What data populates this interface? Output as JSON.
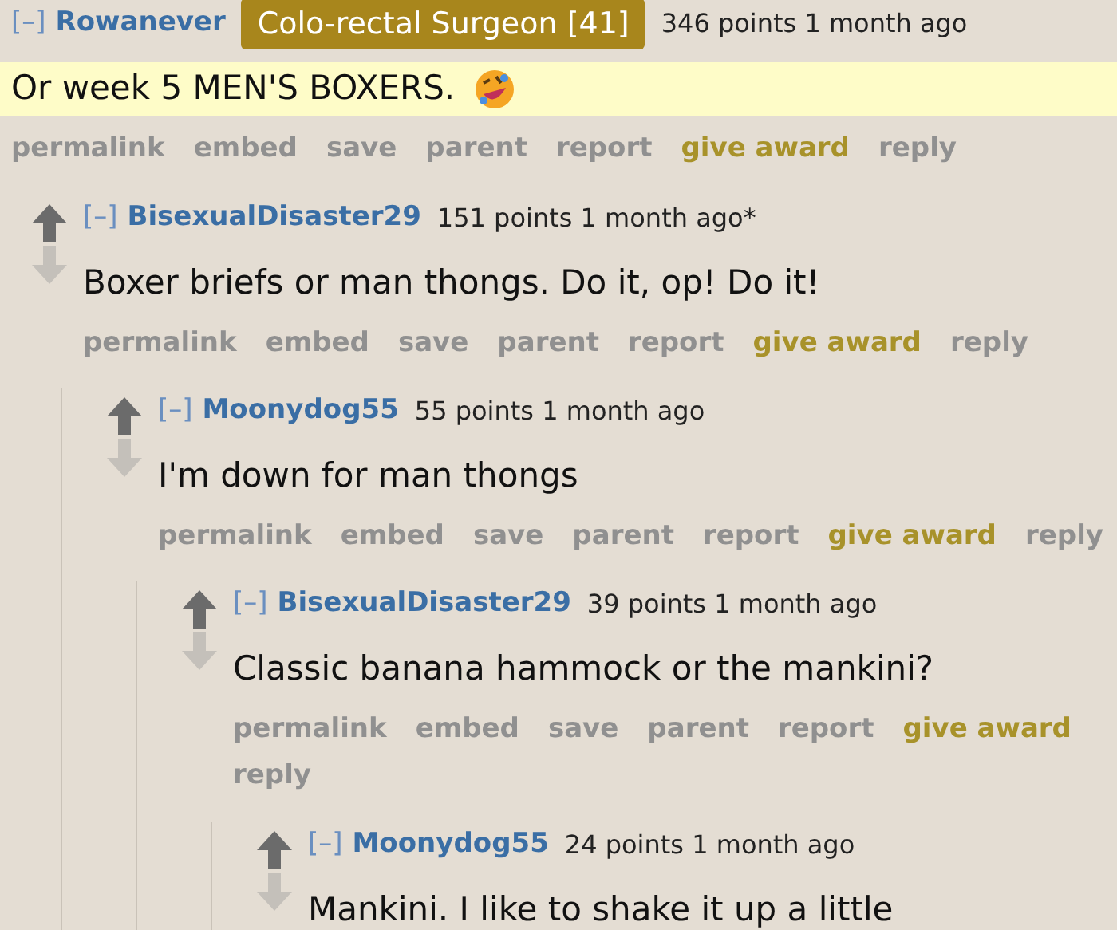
{
  "comments": [
    {
      "toggle": "[–]",
      "author": "Rowanever",
      "flair": "Colo-rectal Surgeon [41]",
      "score": "346 points",
      "time": "1 month ago",
      "vote_arrows": false,
      "highlighted": true,
      "body": "Or week 5 MEN'S BOXERS.",
      "reaction": true,
      "actions": [
        {
          "label": "permalink",
          "kind": "link"
        },
        {
          "label": "embed",
          "kind": "link"
        },
        {
          "label": "save",
          "kind": "link"
        },
        {
          "label": "parent",
          "kind": "link"
        },
        {
          "label": "report",
          "kind": "link"
        },
        {
          "label": "give award",
          "kind": "award"
        },
        {
          "label": "reply",
          "kind": "link"
        }
      ],
      "children": [
        {
          "toggle": "[–]",
          "author": "BisexualDisaster29",
          "score": "151 points",
          "time": "1 month ago*",
          "vote_arrows": true,
          "highlighted": false,
          "body": "Boxer briefs or man thongs. Do it, op! Do it!",
          "reaction": false,
          "actions": [
            {
              "label": "permalink",
              "kind": "link"
            },
            {
              "label": "embed",
              "kind": "link"
            },
            {
              "label": "save",
              "kind": "link"
            },
            {
              "label": "parent",
              "kind": "link"
            },
            {
              "label": "report",
              "kind": "link"
            },
            {
              "label": "give award",
              "kind": "award"
            },
            {
              "label": "reply",
              "kind": "link"
            }
          ],
          "children": [
            {
              "toggle": "[–]",
              "author": "Moonydog55",
              "score": "55 points",
              "time": "1 month ago",
              "vote_arrows": true,
              "highlighted": false,
              "body": "I'm down for man thongs",
              "reaction": false,
              "actions": [
                {
                  "label": "permalink",
                  "kind": "link"
                },
                {
                  "label": "embed",
                  "kind": "link"
                },
                {
                  "label": "save",
                  "kind": "link"
                },
                {
                  "label": "parent",
                  "kind": "link"
                },
                {
                  "label": "report",
                  "kind": "link"
                },
                {
                  "label": "give award",
                  "kind": "award"
                },
                {
                  "label": "reply",
                  "kind": "link"
                }
              ],
              "children": [
                {
                  "toggle": "[–]",
                  "author": "BisexualDisaster29",
                  "score": "39 points",
                  "time": "1 month ago",
                  "vote_arrows": true,
                  "highlighted": false,
                  "body": "Classic banana hammock or the mankini?",
                  "reaction": false,
                  "actions": [
                    {
                      "label": "permalink",
                      "kind": "link"
                    },
                    {
                      "label": "embed",
                      "kind": "link"
                    },
                    {
                      "label": "save",
                      "kind": "link"
                    },
                    {
                      "label": "parent",
                      "kind": "link"
                    },
                    {
                      "label": "report",
                      "kind": "link"
                    },
                    {
                      "label": "give award",
                      "kind": "award"
                    },
                    {
                      "label": "reply",
                      "kind": "link"
                    }
                  ],
                  "children": [
                    {
                      "toggle": "[–]",
                      "author": "Moonydog55",
                      "score": "24 points",
                      "time": "1 month ago",
                      "vote_arrows": true,
                      "highlighted": false,
                      "body": "Mankini. I like to shake it up a little",
                      "reaction": false
                    }
                  ]
                }
              ]
            }
          ]
        }
      ]
    }
  ]
}
